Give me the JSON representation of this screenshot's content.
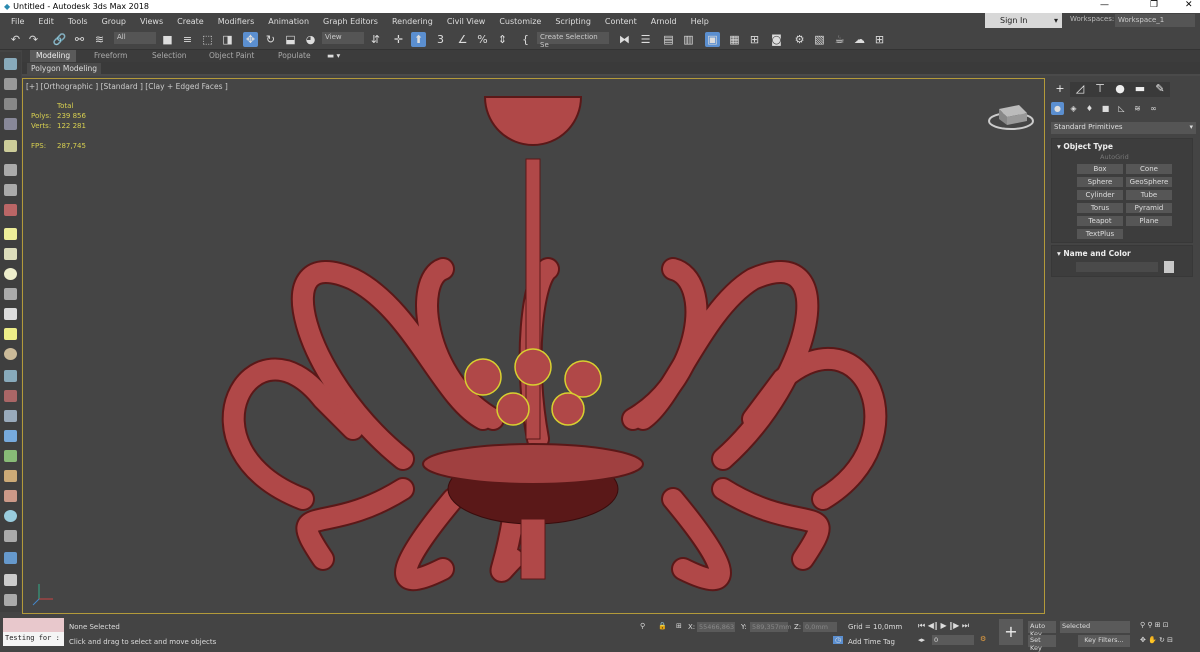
{
  "window": {
    "title": "Untitled - Autodesk 3ds Max 2018"
  },
  "menu": [
    "File",
    "Edit",
    "Tools",
    "Group",
    "Views",
    "Create",
    "Modifiers",
    "Animation",
    "Graph Editors",
    "Rendering",
    "Civil View",
    "Customize",
    "Scripting",
    "Content",
    "Arnold",
    "Help"
  ],
  "account": {
    "sign_in": "Sign In",
    "workspaces_label": "Workspaces:",
    "workspace": "Workspace_1"
  },
  "toolbar": {
    "filter": "All",
    "ref_coord": "View",
    "selection_set": "Create Selection Se"
  },
  "ribbon": {
    "tabs": [
      "Modeling",
      "Freeform",
      "Selection",
      "Object Paint",
      "Populate"
    ],
    "active": "Modeling",
    "sub": "Polygon Modeling"
  },
  "viewport": {
    "label": "[+] [Orthographic ] [Standard ] [Clay + Edged Faces ]",
    "stats": {
      "header": "Total",
      "polys_label": "Polys:",
      "polys": "239 856",
      "verts_label": "Verts:",
      "verts": "122 281",
      "fps_label": "FPS:",
      "fps": "287,745"
    }
  },
  "command_panel": {
    "category": "Standard Primitives",
    "object_type": "Object Type",
    "autogrid": "AutoGrid",
    "buttons": [
      "Box",
      "Cone",
      "Sphere",
      "GeoSphere",
      "Cylinder",
      "Tube",
      "Torus",
      "Pyramid",
      "Teapot",
      "Plane",
      "TextPlus"
    ],
    "name_and_color": "Name and Color",
    "object_color": "#c8c8c8"
  },
  "status": {
    "selection": "None Selected",
    "prompt": "Click and drag to select and move objects",
    "script_listener": "Testing for :",
    "x_label": "X:",
    "x": "55466,863",
    "y_label": "Y:",
    "y": "589,357mm",
    "z_label": "Z:",
    "z": "0,0mm",
    "grid": "Grid = 10,0mm",
    "add_time_tag": "Add Time Tag",
    "frame": "0",
    "auto_key": "Auto Key",
    "set_key": "Set Key",
    "key_mode": "Selected",
    "key_filters": "Key Filters..."
  },
  "colors": {
    "mesh": "#b04848",
    "wire": "#5a1818",
    "viewport_border": "#b39a3a",
    "accent": "#5b8fd0",
    "stats": "#d8d050"
  }
}
